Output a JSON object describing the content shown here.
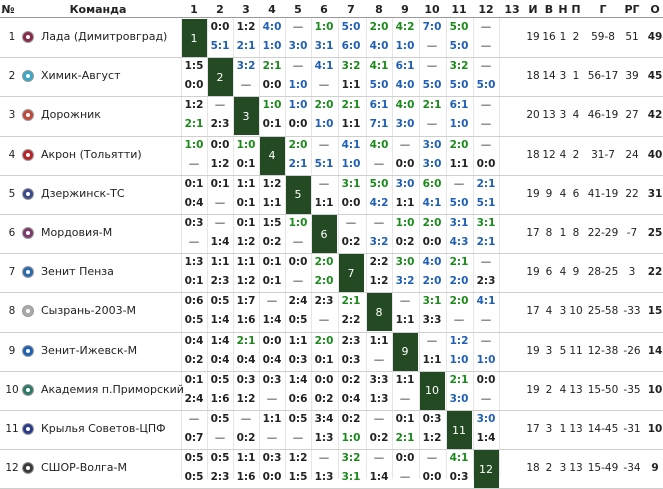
{
  "header": {
    "no": "№",
    "team": "Команда",
    "cols": [
      "1",
      "2",
      "3",
      "4",
      "5",
      "6",
      "7",
      "8",
      "9",
      "10",
      "11",
      "12",
      "13"
    ],
    "stats": [
      "И",
      "В",
      "Н",
      "П",
      "Г",
      "РГ",
      "О"
    ]
  },
  "colors": {
    "win_home": "#1a8a1a",
    "win_away": "#1f5fb5",
    "draw_loss": "#222222",
    "diag": "#234a23"
  },
  "rows": [
    {
      "n": "1",
      "name": "Лада (Димитровград)",
      "logo": "#8a2a4a",
      "top": [
        "",
        "0:0",
        "1:2",
        "4:0",
        "—",
        "1:0",
        "5:0",
        "2:0",
        "4:2",
        "7:0",
        "5:0",
        "—",
        ""
      ],
      "bot": [
        "",
        "5:1",
        "2:1",
        "1:0",
        "3:0",
        "3:1",
        "6:0",
        "4:0",
        "1:0",
        "—",
        "5:0",
        "—",
        ""
      ],
      "stats": [
        "19",
        "16",
        "1",
        "2",
        "59-8",
        "51",
        "49"
      ]
    },
    {
      "n": "2",
      "name": "Химик-Август",
      "logo": "#3aa8c8",
      "top": [
        "1:5",
        "",
        "3:2",
        "2:1",
        "—",
        "4:1",
        "3:2",
        "4:1",
        "6:1",
        "—",
        "3:2",
        "—",
        ""
      ],
      "bot": [
        "0:0",
        "",
        "—",
        "0:0",
        "1:0",
        "—",
        "1:1",
        "5:0",
        "4:0",
        "5:0",
        "5:0",
        "5:0",
        ""
      ],
      "stats": [
        "18",
        "14",
        "3",
        "1",
        "56-17",
        "39",
        "45"
      ]
    },
    {
      "n": "3",
      "name": "Дорожник",
      "logo": "#c24a3a",
      "top": [
        "1:2",
        "—",
        "",
        "1:0",
        "1:0",
        "2:0",
        "2:1",
        "6:1",
        "4:0",
        "2:1",
        "6:1",
        "—",
        ""
      ],
      "bot": [
        "2:1",
        "2:3",
        "",
        "0:1",
        "0:0",
        "1:0",
        "1:1",
        "7:1",
        "3:0",
        "—",
        "1:0",
        "—",
        ""
      ],
      "stats": [
        "20",
        "13",
        "3",
        "4",
        "46-19",
        "27",
        "42"
      ]
    },
    {
      "n": "4",
      "name": "Акрон (Тольятти)",
      "logo": "#b8242a",
      "top": [
        "1:0",
        "0:0",
        "1:0",
        "",
        "2:0",
        "—",
        "4:1",
        "4:0",
        "—",
        "3:0",
        "2:0",
        "—",
        ""
      ],
      "bot": [
        "—",
        "1:2",
        "0:1",
        "",
        "2:1",
        "5:1",
        "1:0",
        "—",
        "0:0",
        "3:0",
        "1:1",
        "0:0",
        ""
      ],
      "stats": [
        "18",
        "12",
        "4",
        "2",
        "31-7",
        "24",
        "40"
      ]
    },
    {
      "n": "5",
      "name": "Дзержинск-ТС",
      "logo": "#3a4a8a",
      "top": [
        "0:1",
        "0:1",
        "1:1",
        "1:2",
        "",
        "—",
        "3:1",
        "5:0",
        "3:0",
        "6:0",
        "—",
        "2:1",
        ""
      ],
      "bot": [
        "0:4",
        "—",
        "0:1",
        "1:1",
        "",
        "1:1",
        "0:0",
        "4:2",
        "1:1",
        "4:1",
        "5:0",
        "5:1",
        ""
      ],
      "stats": [
        "19",
        "9",
        "4",
        "6",
        "41-19",
        "22",
        "31"
      ]
    },
    {
      "n": "6",
      "name": "Мордовия-М",
      "logo": "#7a3a6a",
      "top": [
        "0:3",
        "—",
        "0:1",
        "1:5",
        "1:0",
        "",
        "—",
        "—",
        "1:0",
        "2:0",
        "3:1",
        "3:1",
        ""
      ],
      "bot": [
        "—",
        "1:4",
        "1:2",
        "0:2",
        "—",
        "",
        "0:2",
        "3:2",
        "0:2",
        "0:0",
        "4:3",
        "2:1",
        ""
      ],
      "stats": [
        "17",
        "8",
        "1",
        "8",
        "22-29",
        "-7",
        "25"
      ]
    },
    {
      "n": "7",
      "name": "Зенит Пенза",
      "logo": "#2a6ab0",
      "top": [
        "1:3",
        "1:1",
        "1:1",
        "0:1",
        "0:0",
        "2:0",
        "",
        "2:2",
        "3:0",
        "4:0",
        "2:1",
        "—",
        ""
      ],
      "bot": [
        "0:1",
        "2:3",
        "1:2",
        "0:1",
        "—",
        "2:0",
        "",
        "1:2",
        "3:2",
        "2:0",
        "2:0",
        "2:3",
        ""
      ],
      "stats": [
        "19",
        "6",
        "4",
        "9",
        "28-25",
        "3",
        "22"
      ]
    },
    {
      "n": "8",
      "name": "Сызрань-2003-М",
      "logo": "#aaaaaa",
      "top": [
        "0:6",
        "0:5",
        "1:7",
        "—",
        "2:4",
        "2:3",
        "2:1",
        "",
        "—",
        "3:1",
        "2:0",
        "4:1",
        ""
      ],
      "bot": [
        "0:5",
        "1:4",
        "1:6",
        "1:4",
        "0:5",
        "—",
        "2:2",
        "",
        "1:1",
        "3:3",
        "—",
        "—",
        ""
      ],
      "stats": [
        "17",
        "4",
        "3",
        "10",
        "25-58",
        "-33",
        "15"
      ]
    },
    {
      "n": "9",
      "name": "Зенит-Ижевск-М",
      "logo": "#1f5fb5",
      "top": [
        "0:4",
        "1:4",
        "2:1",
        "0:0",
        "1:1",
        "2:0",
        "2:3",
        "1:1",
        "",
        "—",
        "1:2",
        "—",
        ""
      ],
      "bot": [
        "0:2",
        "0:4",
        "0:4",
        "0:4",
        "0:3",
        "0:1",
        "0:3",
        "—",
        "",
        "1:1",
        "1:0",
        "1:0",
        ""
      ],
      "stats": [
        "19",
        "3",
        "5",
        "11",
        "12-38",
        "-26",
        "14"
      ]
    },
    {
      "n": "10",
      "name": "Академия п.Приморский",
      "logo": "#2a7a6a",
      "top": [
        "0:1",
        "0:5",
        "0:3",
        "0:3",
        "1:4",
        "0:0",
        "0:2",
        "3:3",
        "1:1",
        "",
        "2:1",
        "0:0",
        ""
      ],
      "bot": [
        "2:4",
        "1:6",
        "1:2",
        "—",
        "0:6",
        "0:2",
        "0:4",
        "1:3",
        "—",
        "",
        "3:0",
        "—",
        ""
      ],
      "stats": [
        "19",
        "2",
        "4",
        "13",
        "15-50",
        "-35",
        "10"
      ]
    },
    {
      "n": "11",
      "name": "Крылья Советов-ЦПФ",
      "logo": "#2a3a8a",
      "top": [
        "—",
        "0:5",
        "—",
        "1:1",
        "0:5",
        "3:4",
        "0:2",
        "—",
        "0:1",
        "0:3",
        "",
        "3:0",
        ""
      ],
      "bot": [
        "0:7",
        "—",
        "0:2",
        "—",
        "—",
        "1:3",
        "1:0",
        "0:2",
        "2:1",
        "1:2",
        "",
        "1:4",
        ""
      ],
      "stats": [
        "17",
        "3",
        "1",
        "13",
        "14-45",
        "-31",
        "10"
      ]
    },
    {
      "n": "12",
      "name": "СШОР-Волга-М",
      "logo": "#3a3a3a",
      "top": [
        "0:5",
        "0:5",
        "1:1",
        "0:3",
        "1:2",
        "—",
        "3:2",
        "—",
        "0:0",
        "—",
        "4:1",
        "",
        ""
      ],
      "bot": [
        "0:5",
        "2:3",
        "1:6",
        "0:0",
        "1:5",
        "1:3",
        "3:1",
        "1:4",
        "—",
        "0:0",
        "0:3",
        "",
        ""
      ],
      "stats": [
        "18",
        "2",
        "3",
        "13",
        "15-49",
        "-34",
        "9"
      ]
    }
  ]
}
